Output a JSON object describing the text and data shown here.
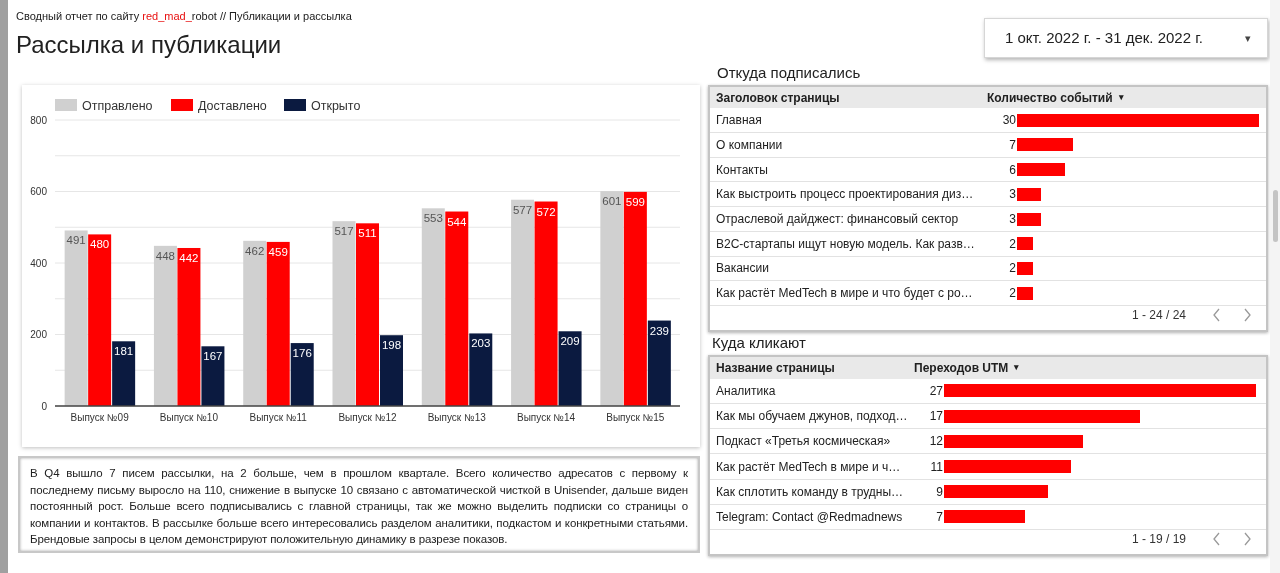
{
  "breadcrumb": [
    {
      "text": "Сводный отчет по сайту ",
      "highlight": false
    },
    {
      "text": "red_mad_",
      "highlight": true
    },
    {
      "text": "robot // Публикации и рассылка",
      "highlight": false
    }
  ],
  "title": "Рассылка и публикации",
  "date_range": {
    "value": "1 окт. 2022 г. - 31 дек. 2022 г.",
    "caret": "▾"
  },
  "chart": {
    "chart_data": {
      "type": "bar",
      "categories": [
        "Выпуск №09",
        "Выпуск №10",
        "Выпуск №11",
        "Выпуск №12",
        "Выпуск №13",
        "Выпуск №14",
        "Выпуск №15"
      ],
      "series": [
        {
          "name": "Отправлено",
          "color": "#d0d0d0",
          "values": [
            491,
            448,
            462,
            517,
            553,
            577,
            601
          ]
        },
        {
          "name": "Доставлено",
          "color": "#ff0000",
          "values": [
            480,
            442,
            459,
            511,
            544,
            572,
            599
          ]
        },
        {
          "name": "Открыто",
          "color": "#0b1a40",
          "values": [
            181,
            167,
            176,
            198,
            203,
            209,
            239
          ]
        }
      ],
      "ylim": [
        0,
        800
      ],
      "yticks": [
        0,
        200,
        400,
        600,
        800
      ],
      "data_labels": true,
      "grid": true,
      "legend": true
    }
  },
  "summary": "В Q4 вышло 7 писем рассылки, на 2 больше, чем в прошлом квартале. Всего количество адресатов с первому к последнему письму выросло на 110, снижение в выпуске 10 связано с автоматической чисткой в Unisender, дальше виден постоянный рост. Больше всего подписывались с главной страницы, так же можно выделить подписки со страницы о компании и контактов. В рассылке больше всего интересовались разделом аналитики, подкастом и конкретными статьями. Брендовые запросы в целом демонстрируют положительную динамику в разрезе показов.",
  "tables": [
    {
      "title": "Откуда подписались",
      "columns": [
        "Заголовок страницы",
        "Количество событий"
      ],
      "sort_caret": "▾",
      "rows": [
        {
          "name": "Главная",
          "value": "30"
        },
        {
          "name": "О компании",
          "value": "7"
        },
        {
          "name": "Контакты",
          "value": "6"
        },
        {
          "name": "Как выстроить процесс проектирования диз…",
          "value": "3"
        },
        {
          "name": "Отраслевой дайджест: финансовый сектор",
          "value": "3"
        },
        {
          "name": "B2C-стартапы ищут новую модель. Как разв…",
          "value": "2"
        },
        {
          "name": "Вакансии",
          "value": "2"
        },
        {
          "name": "Как растёт MedTech в мире и что будет с ро…",
          "value": "2"
        }
      ],
      "pagination": "1 - 24 / 24"
    },
    {
      "title": "Куда кликают",
      "columns": [
        "Название страницы",
        "Переходов UTM"
      ],
      "sort_caret": "▾",
      "rows": [
        {
          "name": "Аналитика",
          "value": "27"
        },
        {
          "name": "Как мы обучаем джунов, подход…",
          "value": "17"
        },
        {
          "name": "Подкаст «Третья космическая»",
          "value": "12"
        },
        {
          "name": "Как растёт MedTech в мире и ч…",
          "value": "11"
        },
        {
          "name": "Как сплотить команду в трудны…",
          "value": "9"
        },
        {
          "name": "Telegram: Contact @Redmadnews",
          "value": "7"
        }
      ],
      "pagination": "1 - 19 / 19"
    }
  ]
}
